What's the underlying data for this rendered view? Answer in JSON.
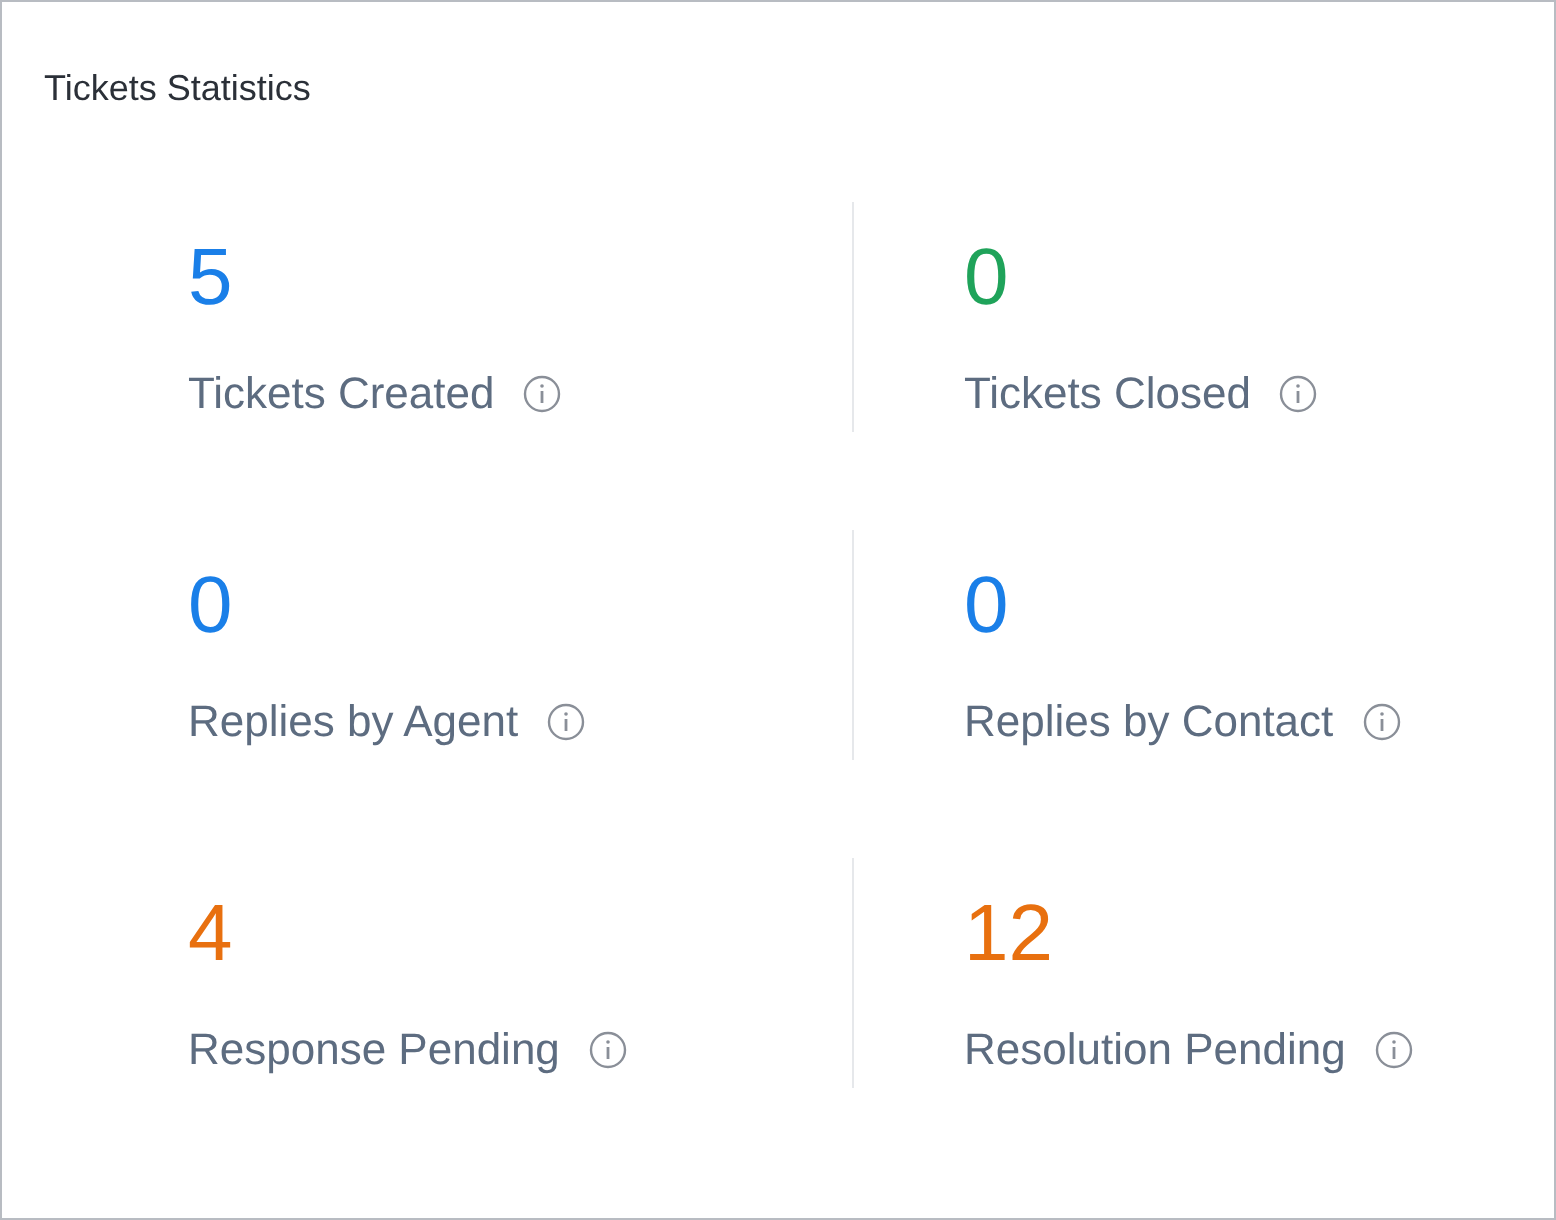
{
  "card": {
    "title": "Tickets Statistics"
  },
  "stats": [
    {
      "value": "5",
      "label": "Tickets Created",
      "color": "#1a7fe8"
    },
    {
      "value": "0",
      "label": "Tickets Closed",
      "color": "#1fa35a"
    },
    {
      "value": "0",
      "label": "Replies by Agent",
      "color": "#1a7fe8"
    },
    {
      "value": "0",
      "label": "Replies by Contact",
      "color": "#1a7fe8"
    },
    {
      "value": "4",
      "label": "Response Pending",
      "color": "#e8700f"
    },
    {
      "value": "12",
      "label": "Resolution Pending",
      "color": "#e8700f"
    }
  ]
}
